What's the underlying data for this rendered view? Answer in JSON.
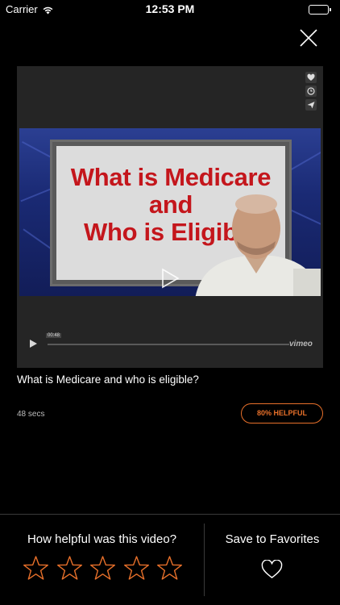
{
  "status_bar": {
    "carrier": "Carrier",
    "time": "12:53 PM",
    "wifi_icon": "wifi-icon",
    "battery_icon": "battery-icon",
    "battery_level": 1.0,
    "battery_color": "#4cd964"
  },
  "header": {
    "close_icon": "close-icon"
  },
  "video": {
    "caption_line1": "What is Medicare",
    "caption_line2": "and",
    "caption_line3": "Who is Eligible",
    "time_badge": "00:48",
    "progress": 0.0,
    "brand": "vimeo",
    "side_icons": [
      "heart-icon",
      "clock-icon",
      "send-icon"
    ]
  },
  "details": {
    "title": "What is Medicare and who is eligible?",
    "duration": "48 secs",
    "helpful_label": "80% HELPFUL",
    "accent_color": "#e8702a"
  },
  "rating": {
    "prompt": "How helpful was this video?",
    "max_stars": 5,
    "selected_stars": 0
  },
  "favorites": {
    "label": "Save to Favorites",
    "icon": "heart-outline-icon"
  }
}
